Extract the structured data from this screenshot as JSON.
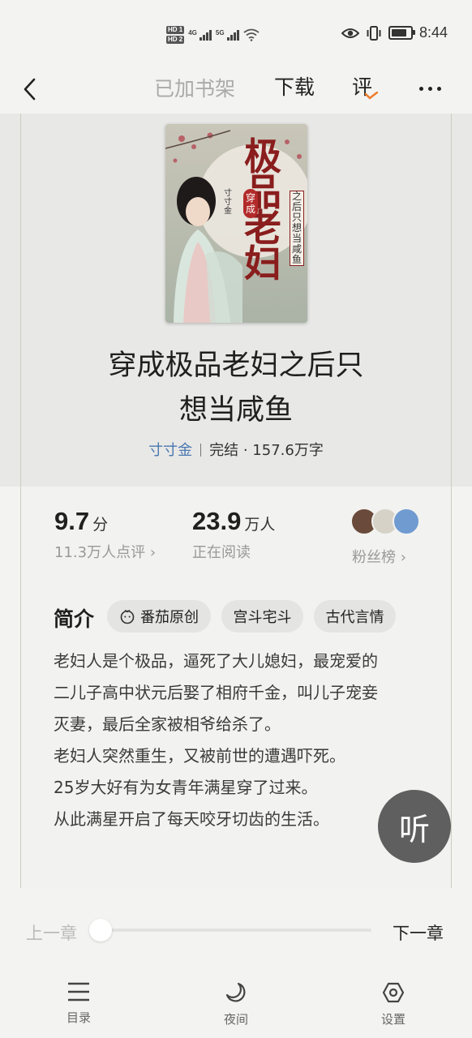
{
  "status_bar": {
    "sim1": "HD 1",
    "sim2": "HD 2",
    "net1": "4G",
    "net2": "5G",
    "time": "8:44",
    "battery_level": 0.8
  },
  "nav": {
    "added_label": "已加书架",
    "download_label": "下载",
    "review_label": "评"
  },
  "book": {
    "title_line1": "穿成极品老妇之后只",
    "title_line2": "想当咸鱼",
    "author": "寸寸金",
    "status": "完结 · 157.6万字",
    "cover": {
      "title_chars": "极品老妇",
      "subtitle": "之后只想当咸鱼",
      "badge": "穿成",
      "author": "寸寸金"
    }
  },
  "stats": {
    "score": "9.7",
    "score_unit": "分",
    "score_sub": "11.3万人点评",
    "readers": "23.9",
    "readers_unit": "万人",
    "readers_sub": "正在阅读",
    "fans_sub": "粉丝榜"
  },
  "intro": {
    "label": "简介",
    "tags": [
      "番茄原创",
      "宫斗宅斗",
      "古代言情"
    ],
    "lines": [
      "老妇人是个极品，逼死了大儿媳妇，最宠爱的",
      "二儿子高中状元后娶了相府千金，叫儿子宠妾",
      "灭妻，最后全家被相爷给杀了。",
      "老妇人突然重生，又被前世的遭遇吓死。",
      "25岁大好有为女青年满星穿了过来。",
      "从此满星开启了每天咬牙切齿的生活。"
    ]
  },
  "listen_label": "听",
  "chapter_nav": {
    "prev": "上一章",
    "next": "下一章",
    "progress": 0
  },
  "bottom_bar": {
    "catalog": "目录",
    "night": "夜间",
    "settings": "设置"
  },
  "colors": {
    "author_link": "#4a78b0",
    "review_check": "#f07a2a",
    "listen_button": "#5f5f5f"
  }
}
